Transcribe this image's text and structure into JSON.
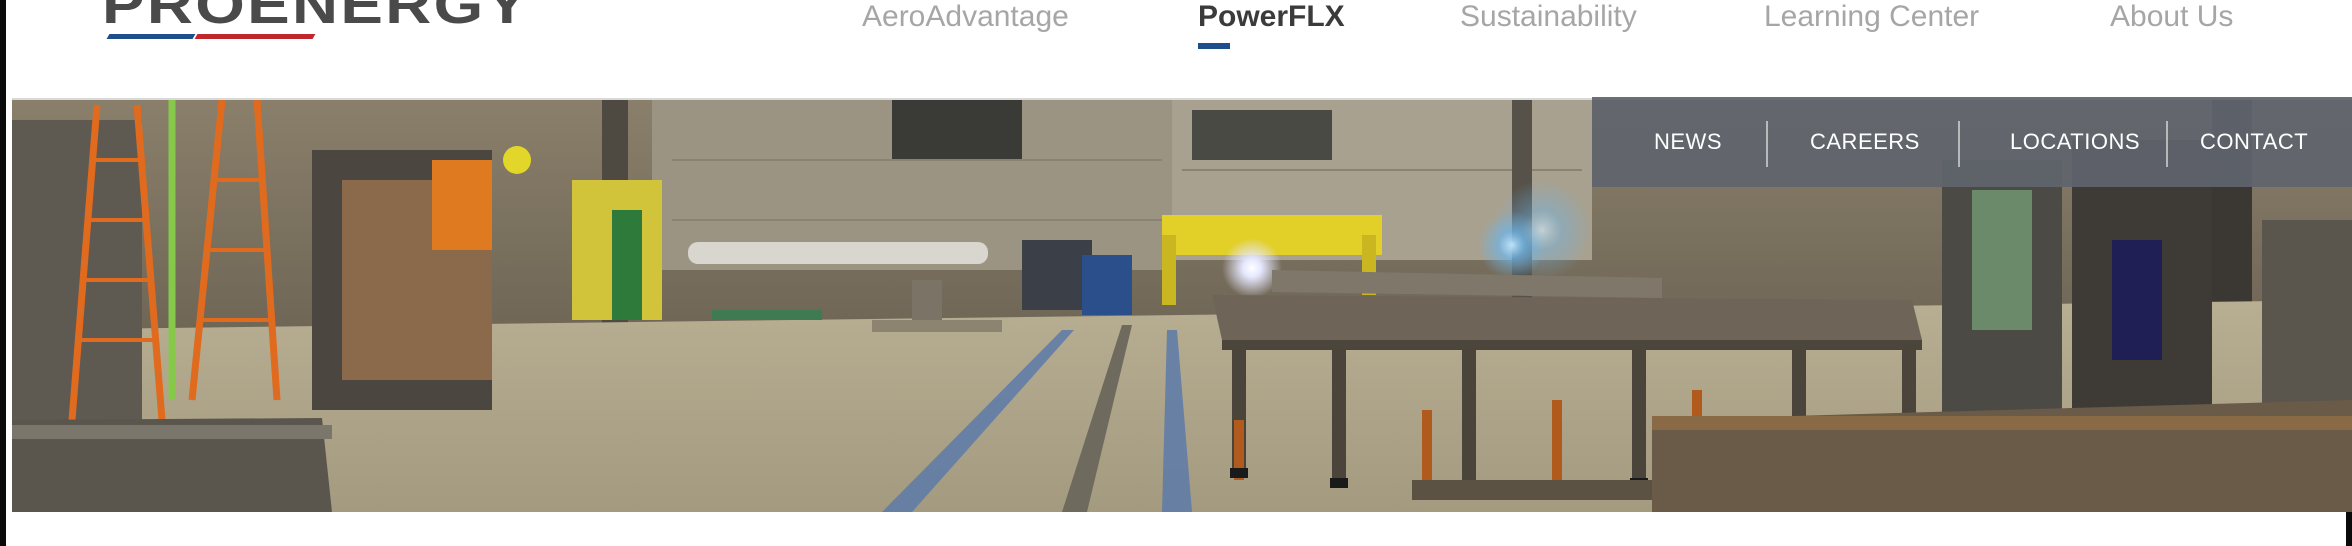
{
  "brand": {
    "name": "PROENERGY",
    "colors": {
      "text": "#4a4a4a",
      "blue": "#1f4e8c",
      "red": "#c0272d"
    }
  },
  "main_nav": {
    "items": [
      {
        "label": "AeroAdvantage",
        "active": false
      },
      {
        "label": "PowerFLX",
        "active": true
      },
      {
        "label": "Sustainability",
        "active": false
      },
      {
        "label": "Learning Center",
        "active": false
      },
      {
        "label": "About Us",
        "active": false
      }
    ],
    "active_color": "#3b3b3b",
    "inactive_color": "#a6a6a6",
    "underline_color": "#1f4e8c"
  },
  "utility_nav": {
    "items": [
      {
        "label": "NEWS"
      },
      {
        "label": "CAREERS"
      },
      {
        "label": "LOCATIONS"
      },
      {
        "label": "CONTACT"
      }
    ],
    "background": "#5f646c"
  },
  "hero": {
    "scene": "fabrication-workshop-photo"
  }
}
